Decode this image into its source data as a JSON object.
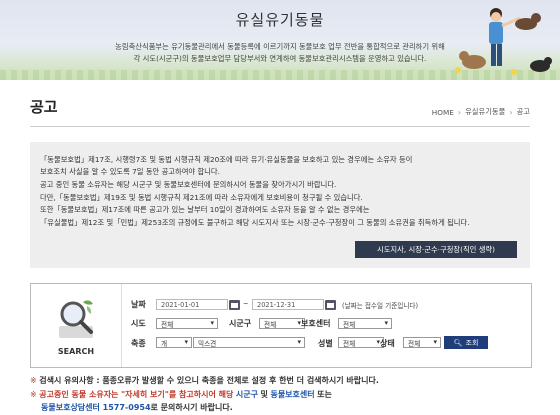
{
  "banner": {
    "title": "유실유기동물",
    "desc_line1": "농림축산식품부는 유기동물관리에서 동물등록에 이르기까지 동물보호 업무 전반을 통합적으로 관리하기 위해",
    "desc_line2": "각 시도(시군구)의 동물보호업무 담당부서와 연계하여 동물보호관리시스템을 운영하고 있습니다."
  },
  "page": {
    "title": "공고",
    "breadcrumb": [
      "HOME",
      "유실유기동물",
      "공고"
    ]
  },
  "notice": {
    "lines": [
      "「동물보호법」제17조, 시행령7조 및 동법 시행규칙 제20조에 따라 유기·유실동물을 보호하고 있는 경우에는 소유자 등이",
      "보호조치 사실을 알 수 있도록 7일 동안 공고하여야 합니다.",
      "공고 중인 동물 소유자는 해당 시군구 및 동물보호센터에 문의하시어 동물을 찾아가시기 바랍니다.",
      "다만,「동물보호법」제19조 및 동법 시행규칙 제21조에 따라 소유자에게 보호비용이 청구될 수 있습니다.",
      "또한「동물보호법」제17조에 따른 공고가 있는 날부터 10일이 경과하여도 소유자 등을 알 수 없는 경우에는",
      "「유실물법」제12조 및「민법」제253조의 규정에도 불구하고 해당 시도지사 또는 시장·군수·구청장이 그 동물의 소유권을 취득하게 됩니다."
    ],
    "button_label": "시도지사, 시장·군수·구청장(직인 생략)"
  },
  "search": {
    "label": "SEARCH",
    "date_label": "날짜",
    "date_from": "2021-01-01",
    "date_to": "2021-12-31",
    "date_sep": "~",
    "date_hint": "(날짜는 접수일 기준입니다)",
    "sido_label": "시도",
    "sido_value": "전체",
    "sigungu_label": "시군구",
    "sigungu_value": "전체",
    "center_label": "보호센터",
    "center_value": "전체",
    "species_label": "축종",
    "species_value": "개",
    "breed_value": "믹스견",
    "sex_label": "성별",
    "sex_value": "전체",
    "status_label": "상태",
    "status_value": "전체",
    "search_button": "조회"
  },
  "warnings": {
    "w1_mark": "※",
    "w1_text": "검색시 유의사항 : 품종오류가 발생할 수 있으니 축종을 전체로 설정 후 한번 더 검색하시기 바랍니다.",
    "w2_mark": "※",
    "w2_a": "공고중인 동물 소유자는",
    "w2_b": "\"자세히 보기\"를 참고하시어 해당",
    "w2_c": "시군구",
    "w2_d": "및",
    "w2_e": "동물보호센터",
    "w2_f": "또는",
    "w3_a": "동물보호상담센터 1577-0954",
    "w3_b": "로 문의하시기 바랍니다."
  }
}
